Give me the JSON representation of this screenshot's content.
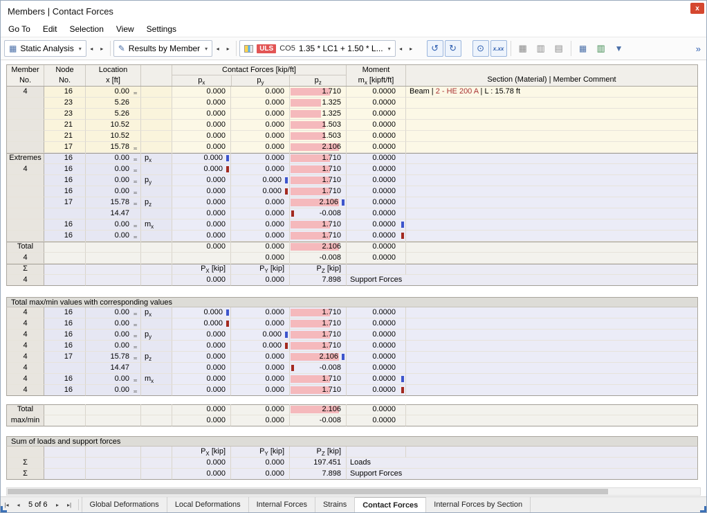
{
  "window": {
    "title": "Members | Contact Forces",
    "close_label": "x"
  },
  "menu": {
    "items": [
      "Go To",
      "Edit",
      "Selection",
      "View",
      "Settings"
    ]
  },
  "toolbar": {
    "static_analysis": "Static Analysis",
    "results_by_member": "Results by Member",
    "uls_badge": "ULS",
    "co_label": "CO5",
    "combination": "1.35 * LC1 + 1.50 * L...",
    "xxx_label": "x.xx",
    "overflow": "»"
  },
  "icons": {
    "chevron_down": "▾",
    "arrow_left": "◂",
    "arrow_right": "▸",
    "grid": "▦",
    "edit": "✎",
    "refresh_ccw": "↺",
    "refresh_cw": "↻",
    "values": "⊙",
    "table": "▦",
    "table_alt": "▥",
    "printer": "▤",
    "table_results": "▦",
    "export": "▥",
    "filter": "▼"
  },
  "table": {
    "support_symbol": "≖",
    "bar_max": 2.106,
    "bar_color": "#f5b9bc",
    "max_marker_color": "#3d55cc",
    "min_marker_color": "#a32a20",
    "header": {
      "member": [
        "Member",
        "No."
      ],
      "node": [
        "Node",
        "No."
      ],
      "location": [
        "Location",
        "x [ft]"
      ],
      "forces_group": "Contact Forces [kip/ft]",
      "force_cols": [
        {
          "pre": "p",
          "sub": "x"
        },
        {
          "pre": "p",
          "sub": "y"
        },
        {
          "pre": "p",
          "sub": "z"
        }
      ],
      "moment_line1": "Moment",
      "moment_line2": {
        "pre": "m",
        "sub": "x",
        "post": " [kipft/ft]"
      },
      "section": "Section (Material) | Member Comment"
    },
    "sections": [
      {
        "type": "rows",
        "rows": [
          {
            "s": "a",
            "m": "4",
            "n": "16",
            "x": "0.00",
            "xs": true,
            "px": "0.000",
            "py": "0.000",
            "pz": "1.710",
            "pzv": 1.71,
            "mx": "0.0000",
            "c": [
              {
                "t": "Beam | ",
                "col": "#000000"
              },
              {
                "t": "2 - HE 200 A",
                "col": "#aa3333"
              },
              {
                "t": " | L : 15.78 ft",
                "col": "#000000"
              }
            ]
          },
          {
            "s": "a",
            "n": "23",
            "x": "5.26",
            "px": "0.000",
            "py": "0.000",
            "pz": "1.325",
            "pzv": 1.325,
            "mx": "0.0000"
          },
          {
            "s": "a",
            "n": "23",
            "x": "5.26",
            "px": "0.000",
            "py": "0.000",
            "pz": "1.325",
            "pzv": 1.325,
            "mx": "0.0000"
          },
          {
            "s": "a",
            "n": "21",
            "x": "10.52",
            "px": "0.000",
            "py": "0.000",
            "pz": "1.503",
            "pzv": 1.503,
            "mx": "0.0000"
          },
          {
            "s": "a",
            "n": "21",
            "x": "10.52",
            "px": "0.000",
            "py": "0.000",
            "pz": "1.503",
            "pzv": 1.503,
            "mx": "0.0000"
          },
          {
            "s": "a",
            "n": "17",
            "x": "15.78",
            "xs": true,
            "px": "0.000",
            "py": "0.000",
            "pz": "2.106",
            "pzv": 2.106,
            "mx": "0.0000"
          },
          {
            "s": "e",
            "top": true,
            "m": "Extremes",
            "n": "16",
            "x": "0.00",
            "xs": true,
            "q": {
              "pre": "p",
              "sub": "x"
            },
            "px": "0.000",
            "pxm": "max",
            "py": "0.000",
            "pz": "1.710",
            "pzv": 1.71,
            "mx": "0.0000"
          },
          {
            "s": "e",
            "m": "4",
            "n": "16",
            "x": "0.00",
            "xs": true,
            "px": "0.000",
            "pxm": "min",
            "py": "0.000",
            "pz": "1.710",
            "pzv": 1.71,
            "mx": "0.0000"
          },
          {
            "s": "e",
            "n": "16",
            "x": "0.00",
            "xs": true,
            "q": {
              "pre": "p",
              "sub": "y"
            },
            "px": "0.000",
            "py": "0.000",
            "pym": "max",
            "pz": "1.710",
            "pzv": 1.71,
            "mx": "0.0000"
          },
          {
            "s": "e",
            "n": "16",
            "x": "0.00",
            "xs": true,
            "px": "0.000",
            "py": "0.000",
            "pym": "min",
            "pz": "1.710",
            "pzv": 1.71,
            "mx": "0.0000"
          },
          {
            "s": "e",
            "n": "17",
            "x": "15.78",
            "xs": true,
            "q": {
              "pre": "p",
              "sub": "z"
            },
            "px": "0.000",
            "py": "0.000",
            "pz": "2.106",
            "pzv": 2.106,
            "pzm": "max",
            "mx": "0.0000"
          },
          {
            "s": "e",
            "x": "14.47",
            "px": "0.000",
            "py": "0.000",
            "pz": "-0.008",
            "pzv": -0.008,
            "pzm": "min",
            "mx": "0.0000"
          },
          {
            "s": "e",
            "n": "16",
            "x": "0.00",
            "xs": true,
            "q": {
              "pre": "m",
              "sub": "x"
            },
            "px": "0.000",
            "py": "0.000",
            "pz": "1.710",
            "pzv": 1.71,
            "mx": "0.0000",
            "mxm": "max"
          },
          {
            "s": "e",
            "n": "16",
            "x": "0.00",
            "xs": true,
            "px": "0.000",
            "py": "0.000",
            "pz": "1.710",
            "pzv": 1.71,
            "mx": "0.0000",
            "mxm": "min"
          },
          {
            "s": "t",
            "top": true,
            "m": "Total",
            "px": "0.000",
            "py": "0.000",
            "pz": "2.106",
            "pzv": 2.106,
            "mx": "0.0000"
          },
          {
            "s": "t",
            "m": "4",
            "px": "",
            "py": "0.000",
            "pz": "-0.008",
            "mx": "0.0000"
          },
          {
            "s": "s",
            "top": true,
            "m": "Σ",
            "sumhead": true,
            "cols": [
              {
                "pre": "P",
                "sub": "X",
                "post": " [kip]"
              },
              {
                "pre": "P",
                "sub": "Y",
                "post": " [kip]"
              },
              {
                "pre": "P",
                "sub": "Z",
                "post": " [kip]"
              }
            ]
          },
          {
            "s": "s",
            "bot": true,
            "m": "4",
            "px": "0.000",
            "py": "0.000",
            "pz": "7.898",
            "cspan": true,
            "c": "Support Forces"
          }
        ]
      },
      {
        "type": "spacer",
        "h": 16
      },
      {
        "type": "band",
        "text": "Total max/min values with corresponding values"
      },
      {
        "type": "rows",
        "rows": [
          {
            "s": "e",
            "m": "4",
            "n": "16",
            "x": "0.00",
            "xs": true,
            "q": {
              "pre": "p",
              "sub": "x"
            },
            "px": "0.000",
            "pxm": "max",
            "py": "0.000",
            "pz": "1.710",
            "pzv": 1.71,
            "mx": "0.0000"
          },
          {
            "s": "e",
            "m": "4",
            "n": "16",
            "x": "0.00",
            "xs": true,
            "px": "0.000",
            "pxm": "min",
            "py": "0.000",
            "pz": "1.710",
            "pzv": 1.71,
            "mx": "0.0000"
          },
          {
            "s": "e",
            "m": "4",
            "n": "16",
            "x": "0.00",
            "xs": true,
            "q": {
              "pre": "p",
              "sub": "y"
            },
            "px": "0.000",
            "py": "0.000",
            "pym": "max",
            "pz": "1.710",
            "pzv": 1.71,
            "mx": "0.0000"
          },
          {
            "s": "e",
            "m": "4",
            "n": "16",
            "x": "0.00",
            "xs": true,
            "px": "0.000",
            "py": "0.000",
            "pym": "min",
            "pz": "1.710",
            "pzv": 1.71,
            "mx": "0.0000"
          },
          {
            "s": "e",
            "m": "4",
            "n": "17",
            "x": "15.78",
            "xs": true,
            "q": {
              "pre": "p",
              "sub": "z"
            },
            "px": "0.000",
            "py": "0.000",
            "pz": "2.106",
            "pzv": 2.106,
            "pzm": "max",
            "mx": "0.0000"
          },
          {
            "s": "e",
            "m": "4",
            "x": "14.47",
            "px": "0.000",
            "py": "0.000",
            "pz": "-0.008",
            "pzv": -0.008,
            "pzm": "min",
            "mx": "0.0000"
          },
          {
            "s": "e",
            "m": "4",
            "n": "16",
            "x": "0.00",
            "xs": true,
            "q": {
              "pre": "m",
              "sub": "x"
            },
            "px": "0.000",
            "py": "0.000",
            "pz": "1.710",
            "pzv": 1.71,
            "mx": "0.0000",
            "mxm": "max"
          },
          {
            "s": "e",
            "bot": true,
            "m": "4",
            "n": "16",
            "x": "0.00",
            "xs": true,
            "px": "0.000",
            "py": "0.000",
            "pz": "1.710",
            "pzv": 1.71,
            "mx": "0.0000",
            "mxm": "min"
          }
        ]
      },
      {
        "type": "spacer",
        "h": 12
      },
      {
        "type": "rows",
        "rows": [
          {
            "s": "t",
            "top": true,
            "m": "Total",
            "px": "0.000",
            "py": "0.000",
            "pz": "2.106",
            "pzv": 2.106,
            "mx": "0.0000"
          },
          {
            "s": "t",
            "bot": true,
            "m": "max/min",
            "px": "0.000",
            "py": "0.000",
            "pz": "-0.008",
            "mx": "0.0000"
          }
        ]
      },
      {
        "type": "spacer",
        "h": 14
      },
      {
        "type": "band",
        "text": "Sum of loads and support forces"
      },
      {
        "type": "rows",
        "rows": [
          {
            "s": "s",
            "m": "",
            "sumhead": true,
            "cols": [
              {
                "pre": "P",
                "sub": "X",
                "post": " [kip]"
              },
              {
                "pre": "P",
                "sub": "Y",
                "post": " [kip]"
              },
              {
                "pre": "P",
                "sub": "Z",
                "post": " [kip]"
              }
            ]
          },
          {
            "s": "s",
            "m": "Σ",
            "px": "0.000",
            "py": "0.000",
            "pz": "197.451",
            "cspan": true,
            "c": "Loads"
          },
          {
            "s": "s",
            "bot": true,
            "m": "Σ",
            "px": "0.000",
            "py": "0.000",
            "pz": "7.898",
            "cspan": true,
            "c": "Support Forces"
          }
        ]
      }
    ]
  },
  "tabs": {
    "nav_first": "|◂",
    "nav_prev": "◂",
    "nav_next": "▸",
    "nav_last": "▸|",
    "page_label": "5 of 6",
    "items": [
      "Global Deformations",
      "Local Deformations",
      "Internal Forces",
      "Strains",
      "Contact Forces",
      "Internal Forces by Section"
    ],
    "active_index": 4
  }
}
